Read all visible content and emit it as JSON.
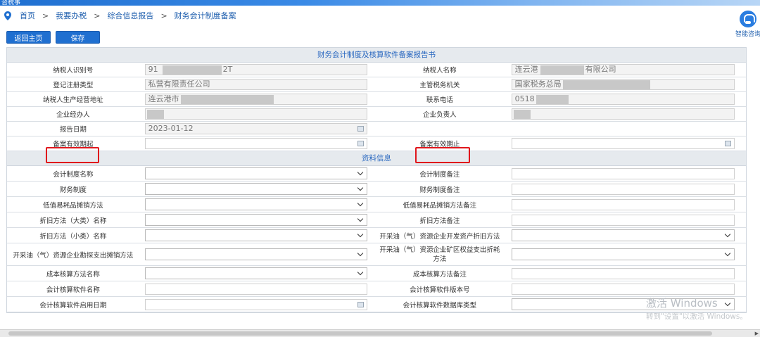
{
  "header": {
    "logo_text": "咨税事"
  },
  "breadcrumb": {
    "items": [
      "首页",
      "我要办税",
      "综合信息报告",
      "财务会计制度备案"
    ],
    "separator": ">"
  },
  "toolbar": {
    "back_label": "返回主页",
    "save_label": "保存"
  },
  "assistant": {
    "label": "智能咨询"
  },
  "form": {
    "title": "财务会计制度及核算软件备案报告书",
    "info_rows": [
      {
        "l1": "纳税人识别号",
        "v1a": "91",
        "v1b": "2T",
        "l2": "纳税人名称",
        "v2a": "连云港",
        "v2b": "有限公司"
      },
      {
        "l1": "登记注册类型",
        "v1a": "私营有限责任公司",
        "v1b": "",
        "l2": "主管税务机关",
        "v2a": "国家税务总局",
        "v2b": ""
      },
      {
        "l1": "纳税人生产经营地址",
        "v1a": "连云港市",
        "v1b": "",
        "l2": "联系电话",
        "v2a": "0518",
        "v2b": ""
      },
      {
        "l1": "企业经办人",
        "v1a": "",
        "v1b": "",
        "l2": "企业负责人",
        "v2a": "",
        "v2b": ""
      }
    ],
    "report_date_label": "报告日期",
    "report_date_value": "2023-01-12",
    "valid_from_label": "备案有效期起",
    "valid_to_label": "备案有效期止",
    "section2_title": "资料信息",
    "material_rows": [
      {
        "l1": "会计制度名称",
        "t1": "select",
        "l2": "会计制度备注",
        "t2": "input"
      },
      {
        "l1": "财务制度",
        "t1": "select",
        "l2": "财务制度备注",
        "t2": "input"
      },
      {
        "l1": "低值易耗品摊销方法",
        "t1": "select",
        "l2": "低值易耗品摊销方法备注",
        "t2": "input"
      },
      {
        "l1": "折旧方法（大类）名称",
        "t1": "select",
        "l2": "折旧方法备注",
        "t2": "input"
      },
      {
        "l1": "折旧方法（小类）名称",
        "t1": "select",
        "l2": "开采油（气）资源企业开发资产折旧方法",
        "t2": "select"
      },
      {
        "l1": "开采油（气）资源企业勘探支出摊销方法",
        "t1": "select",
        "l2": "开采油（气）资源企业矿区权益支出折耗方法",
        "t2": "select"
      },
      {
        "l1": "成本核算方法名称",
        "t1": "select",
        "l2": "成本核算方法备注",
        "t2": "input"
      },
      {
        "l1": "会计核算软件名称",
        "t1": "input",
        "l2": "会计核算软件版本号",
        "t2": "input"
      },
      {
        "l1": "会计核算软件启用日期",
        "t1": "date",
        "l2": "会计核算软件数据库类型",
        "t2": "select"
      }
    ]
  },
  "watermark": {
    "line1": "激活 Windows",
    "line2": "转到\"设置\"以激活 Windows。"
  },
  "colors": {
    "accent": "#1f6fd0",
    "highlight": "#e0161c",
    "section_bg": "#e6eaee"
  }
}
